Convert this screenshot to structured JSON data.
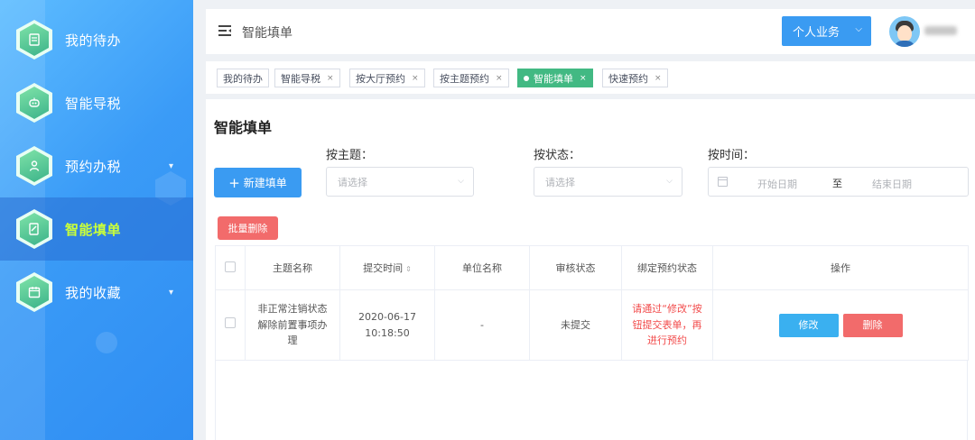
{
  "sidebar": {
    "items": [
      {
        "label": "我的待办",
        "icon": "document-list-icon"
      },
      {
        "label": "智能导税",
        "icon": "robot-icon"
      },
      {
        "label": "预约办税",
        "icon": "person-icon",
        "has_submenu": true
      },
      {
        "label": "智能填单",
        "icon": "form-edit-icon",
        "active": true
      },
      {
        "label": "我的收藏",
        "icon": "calendar-icon",
        "has_submenu": true
      }
    ]
  },
  "header": {
    "title": "智能填单",
    "business_button": "个人业务"
  },
  "tabs": [
    {
      "label": "我的待办",
      "closable": false
    },
    {
      "label": "智能导税",
      "closable": true
    },
    {
      "label": "按大厅预约",
      "closable": true
    },
    {
      "label": "按主题预约",
      "closable": true
    },
    {
      "label": "智能填单",
      "closable": true,
      "active": true
    },
    {
      "label": "快速预约",
      "closable": true
    }
  ],
  "main": {
    "title": "智能填单",
    "new_button": "新建填单",
    "batch_delete_button": "批量删除",
    "filters": {
      "topic_label": "按主题：",
      "topic_placeholder": "请选择",
      "status_label": "按状态：",
      "status_placeholder": "请选择",
      "time_label": "按时间：",
      "start_placeholder": "开始日期",
      "range_separator": "至",
      "end_placeholder": "结束日期"
    },
    "table": {
      "headers": [
        "主题名称",
        "提交时间",
        "单位名称",
        "审核状态",
        "绑定预约状态",
        "操作"
      ],
      "rows": [
        {
          "topic": "非正常注销状态解除前置事项办理",
          "submit_time": "2020-06-17 10:18:50",
          "unit": "-",
          "review_status": "未提交",
          "binding_status": "请通过“修改”按钮提交表单，再进行预约",
          "edit": "修改",
          "delete": "删除"
        }
      ]
    }
  },
  "colors": {
    "primary": "#3a9bf2",
    "tab_active": "#42b983",
    "danger": "#f26b6b",
    "sidebar_active_text": "#c9ff3a"
  }
}
